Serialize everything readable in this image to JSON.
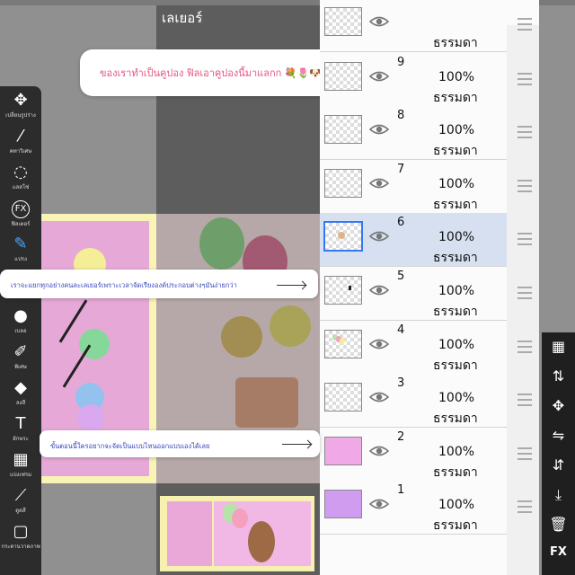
{
  "panel": {
    "title": "เลเยอร์"
  },
  "search": {
    "text": "ของเราทำเป็นคูปอง ฟิลเอาคูปองนี้มาแลกก 💐🌷🐶"
  },
  "tooltips": [
    {
      "text": "เราจะแยกทุกอย่างคนละเลเยอร์เพราะเวลาจัดเรียงองค์ประกอบต่างๆมันง่ายกว่า"
    },
    {
      "text": "ขั้นตอนนี้ใครอยากจะจัดเป็นแบบไหนออกแบบเองได้เลย"
    }
  ],
  "tools": [
    {
      "icon": "move-icon",
      "glyph": "✥",
      "label": "เปลี่ยนรูปร่าง"
    },
    {
      "icon": "magic-wand-icon",
      "glyph": "⁄",
      "label": "คทาวิเศษ"
    },
    {
      "icon": "lasso-icon",
      "glyph": "◌",
      "label": "แลสโซ่"
    },
    {
      "icon": "fx-icon",
      "glyph": "FX",
      "label": "ฟิลเตอร์"
    },
    {
      "icon": "brush-icon",
      "glyph": "✎",
      "label": "แปรง"
    },
    {
      "icon": "smudge-icon",
      "glyph": "☁",
      "label": "ทำรอยเปื้อน"
    },
    {
      "icon": "blur-icon",
      "glyph": "●",
      "label": "เบลอ"
    },
    {
      "icon": "special-brush-icon",
      "glyph": "✐",
      "label": "พิเศษ"
    },
    {
      "icon": "fill-icon",
      "glyph": "◆",
      "label": "ลงสี"
    },
    {
      "icon": "text-icon",
      "glyph": "T",
      "label": "อักษระ"
    },
    {
      "icon": "frame-divider-icon",
      "glyph": "▦",
      "label": "แบ่งเฟรม"
    },
    {
      "icon": "eyedropper-icon",
      "glyph": "⟋",
      "label": "ดูดสี"
    },
    {
      "icon": "canvas-icon",
      "glyph": "▢",
      "label": "กระดานวาดภาพ"
    }
  ],
  "layers": [
    {
      "number": "",
      "opacity": "",
      "blend": "ธรรมดา",
      "thumb": "empty",
      "selected": false
    },
    {
      "number": "9",
      "opacity": "100%",
      "blend": "ธรรมดา",
      "thumb": "empty",
      "selected": false
    },
    {
      "number": "8",
      "opacity": "100%",
      "blend": "ธรรมดา",
      "thumb": "empty",
      "selected": false
    },
    {
      "number": "7",
      "opacity": "100%",
      "blend": "ธรรมดา",
      "thumb": "empty",
      "selected": false
    },
    {
      "number": "6",
      "opacity": "100%",
      "blend": "ธรรมดา",
      "thumb": "bear",
      "selected": true
    },
    {
      "number": "5",
      "opacity": "100%",
      "blend": "ธรรมดา",
      "thumb": "dot",
      "selected": false
    },
    {
      "number": "4",
      "opacity": "100%",
      "blend": "ธรรมดา",
      "thumb": "balloons",
      "selected": false
    },
    {
      "number": "3",
      "opacity": "100%",
      "blend": "ธรรมดา",
      "thumb": "empty",
      "selected": false
    },
    {
      "number": "2",
      "opacity": "100%",
      "blend": "ธรรมดา",
      "thumb": "pink",
      "selected": false
    },
    {
      "number": "1",
      "opacity": "100%",
      "blend": "ธรรมดา",
      "thumb": "purple",
      "selected": false
    }
  ],
  "right_tools": [
    {
      "icon": "checker-icon"
    },
    {
      "icon": "swap-layers-icon"
    },
    {
      "icon": "move-icon"
    },
    {
      "icon": "flip-horizontal-icon"
    },
    {
      "icon": "flip-vertical-icon"
    },
    {
      "icon": "merge-down-icon"
    },
    {
      "icon": "trash-icon"
    },
    {
      "icon": "fx-icon",
      "label": "FX"
    }
  ],
  "colors": {
    "accent": "#3478f6",
    "ticket_pink": "#e6a9d7",
    "ticket_yellow": "#f8f4b5",
    "tip_text": "#3344bb",
    "search_text": "#e2557e"
  }
}
